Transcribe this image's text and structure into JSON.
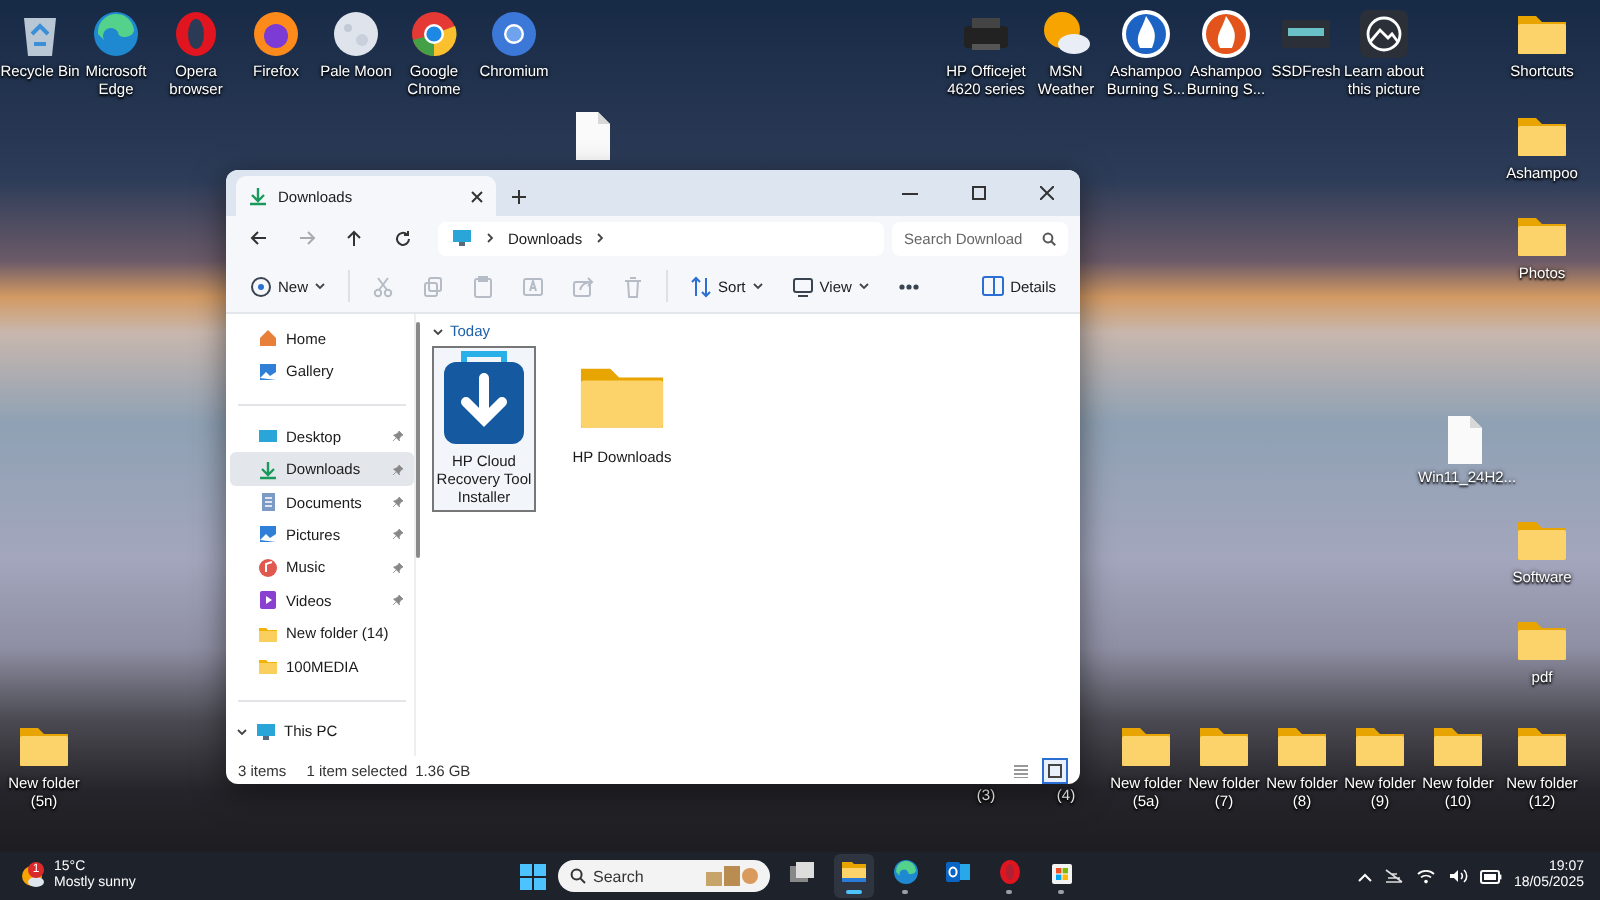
{
  "desktop_icons": [
    {
      "kind": "bin",
      "label": "Recycle Bin"
    },
    {
      "kind": "edge",
      "label": "Microsoft Edge"
    },
    {
      "kind": "opera",
      "label": "Opera browser"
    },
    {
      "kind": "firefox",
      "label": "Firefox"
    },
    {
      "kind": "palemoon",
      "label": "Pale Moon"
    },
    {
      "kind": "chrome",
      "label": "Google Chrome"
    },
    {
      "kind": "chromium",
      "label": "Chromium"
    },
    {
      "kind": "file"
    },
    {
      "kind": "printer",
      "label": "HP Officejet 4620 series"
    },
    {
      "kind": "weather",
      "label": "MSN Weather"
    },
    {
      "kind": "flame_blue",
      "label": "Ashampoo Burning S..."
    },
    {
      "kind": "flame_red",
      "label": "Ashampoo Burning S..."
    },
    {
      "kind": "ssd",
      "label": "SSDFresh"
    },
    {
      "kind": "picture",
      "label": "Learn about this picture"
    },
    {
      "kind": "folder",
      "label": "Shortcuts"
    },
    {
      "kind": "folder",
      "label": "Ashampoo"
    },
    {
      "kind": "folder",
      "label": "Photos"
    },
    {
      "kind": "file",
      "label": "Win11_24H2..."
    },
    {
      "kind": "folder",
      "label": "Software"
    },
    {
      "kind": "folder",
      "label": "pdf"
    },
    {
      "kind": "folder",
      "label": "New folder (5n)"
    },
    {
      "kind": "partial",
      "label": "(3)"
    },
    {
      "kind": "partial",
      "label": "(4)"
    },
    {
      "kind": "folder",
      "label": "New folder (5a)"
    },
    {
      "kind": "folder",
      "label": "New folder (7)"
    },
    {
      "kind": "folder",
      "label": "New folder (8)"
    },
    {
      "kind": "folder",
      "label": "New folder (9)"
    },
    {
      "kind": "folder",
      "label": "New folder (10)"
    },
    {
      "kind": "folder",
      "label": "New folder (12)"
    }
  ],
  "explorer": {
    "tab_title": "Downloads",
    "address": "Downloads",
    "search": {
      "placeholder": "Search Download"
    },
    "toolbar": [
      {
        "kind": "new",
        "label": "New",
        "disabled": false
      },
      {
        "kind": "cut",
        "disabled": true
      },
      {
        "kind": "copy",
        "disabled": true
      },
      {
        "kind": "paste",
        "disabled": true
      },
      {
        "kind": "rename",
        "disabled": true
      },
      {
        "kind": "share",
        "disabled": true
      },
      {
        "kind": "delete",
        "disabled": true
      },
      {
        "kind": "sort",
        "label": "Sort",
        "disabled": false
      },
      {
        "kind": "view",
        "label": "View",
        "disabled": false
      },
      {
        "kind": "more",
        "disabled": false
      }
    ],
    "details_label": "Details",
    "sidebar": {
      "top": [
        {
          "kind": "home",
          "label": "Home",
          "selected": false
        },
        {
          "kind": "gallery",
          "label": "Gallery",
          "selected": false
        }
      ],
      "quick": [
        {
          "kind": "desktop",
          "label": "Desktop",
          "pinned": true,
          "selected": false
        },
        {
          "kind": "downloads",
          "label": "Downloads",
          "pinned": true,
          "selected": true
        },
        {
          "kind": "documents",
          "label": "Documents",
          "pinned": true,
          "selected": false
        },
        {
          "kind": "pictures",
          "label": "Pictures",
          "pinned": true,
          "selected": false
        },
        {
          "kind": "music",
          "label": "Music",
          "pinned": true,
          "selected": false
        },
        {
          "kind": "videos",
          "label": "Videos",
          "pinned": true,
          "selected": false
        },
        {
          "kind": "folder",
          "label": "New folder (14)",
          "pinned": false,
          "selected": false
        },
        {
          "kind": "folder",
          "label": "100MEDIA",
          "pinned": false,
          "selected": false
        }
      ],
      "this_pc": {
        "label": "This PC",
        "expanded": true
      }
    },
    "group": "Today",
    "files": [
      {
        "kind": "installer",
        "name": "HP Cloud Recovery Tool Installer",
        "selected": true
      },
      {
        "kind": "folder",
        "name": "HP Downloads",
        "selected": false
      }
    ],
    "status": {
      "count": "3 items",
      "selection": "1 item selected",
      "size": "1.36 GB"
    },
    "views": [
      {
        "kind": "details",
        "selected": false
      },
      {
        "kind": "large_icons",
        "selected": true
      }
    ]
  },
  "taskbar": {
    "weather": {
      "badge": "1",
      "temperature": "15°C",
      "condition": "Mostly sunny"
    },
    "search": {
      "placeholder": "Search"
    },
    "apps": [
      {
        "kind": "taskview",
        "running": false,
        "focused": false
      },
      {
        "kind": "explorer",
        "running": true,
        "focused": true
      },
      {
        "kind": "edge",
        "running": true,
        "focused": false
      },
      {
        "kind": "outlook",
        "running": false,
        "focused": false
      },
      {
        "kind": "opera",
        "running": true,
        "focused": false
      },
      {
        "kind": "store",
        "running": true,
        "focused": false
      }
    ],
    "time": "19:07",
    "date": "18/05/2025"
  }
}
